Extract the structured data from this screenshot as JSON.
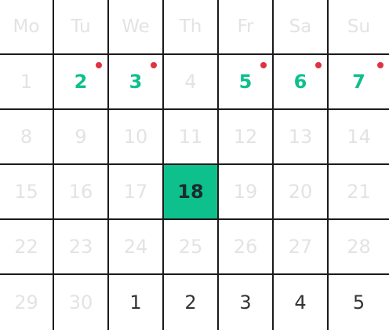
{
  "calendar": {
    "weekdays": [
      "Mo",
      "Tu",
      "We",
      "Th",
      "Fr",
      "Sa",
      "Su"
    ],
    "accent_color": "#0ec08c",
    "event_dot_color": "#e03243",
    "weeks": [
      [
        {
          "label": "1",
          "state": "muted"
        },
        {
          "label": "2",
          "state": "event"
        },
        {
          "label": "3",
          "state": "event"
        },
        {
          "label": "4",
          "state": "muted"
        },
        {
          "label": "5",
          "state": "event"
        },
        {
          "label": "6",
          "state": "event"
        },
        {
          "label": "7",
          "state": "event"
        }
      ],
      [
        {
          "label": "8",
          "state": "muted"
        },
        {
          "label": "9",
          "state": "muted"
        },
        {
          "label": "10",
          "state": "muted"
        },
        {
          "label": "11",
          "state": "muted"
        },
        {
          "label": "12",
          "state": "muted"
        },
        {
          "label": "13",
          "state": "muted"
        },
        {
          "label": "14",
          "state": "muted"
        }
      ],
      [
        {
          "label": "15",
          "state": "muted"
        },
        {
          "label": "16",
          "state": "muted"
        },
        {
          "label": "17",
          "state": "muted"
        },
        {
          "label": "18",
          "state": "selected"
        },
        {
          "label": "19",
          "state": "muted"
        },
        {
          "label": "20",
          "state": "muted"
        },
        {
          "label": "21",
          "state": "muted"
        }
      ],
      [
        {
          "label": "22",
          "state": "muted"
        },
        {
          "label": "23",
          "state": "muted"
        },
        {
          "label": "24",
          "state": "muted"
        },
        {
          "label": "25",
          "state": "muted"
        },
        {
          "label": "26",
          "state": "muted"
        },
        {
          "label": "27",
          "state": "muted"
        },
        {
          "label": "28",
          "state": "muted"
        }
      ],
      [
        {
          "label": "29",
          "state": "muted"
        },
        {
          "label": "30",
          "state": "muted"
        },
        {
          "label": "1",
          "state": "upcoming"
        },
        {
          "label": "2",
          "state": "upcoming"
        },
        {
          "label": "3",
          "state": "upcoming"
        },
        {
          "label": "4",
          "state": "upcoming"
        },
        {
          "label": "5",
          "state": "upcoming"
        }
      ]
    ]
  }
}
